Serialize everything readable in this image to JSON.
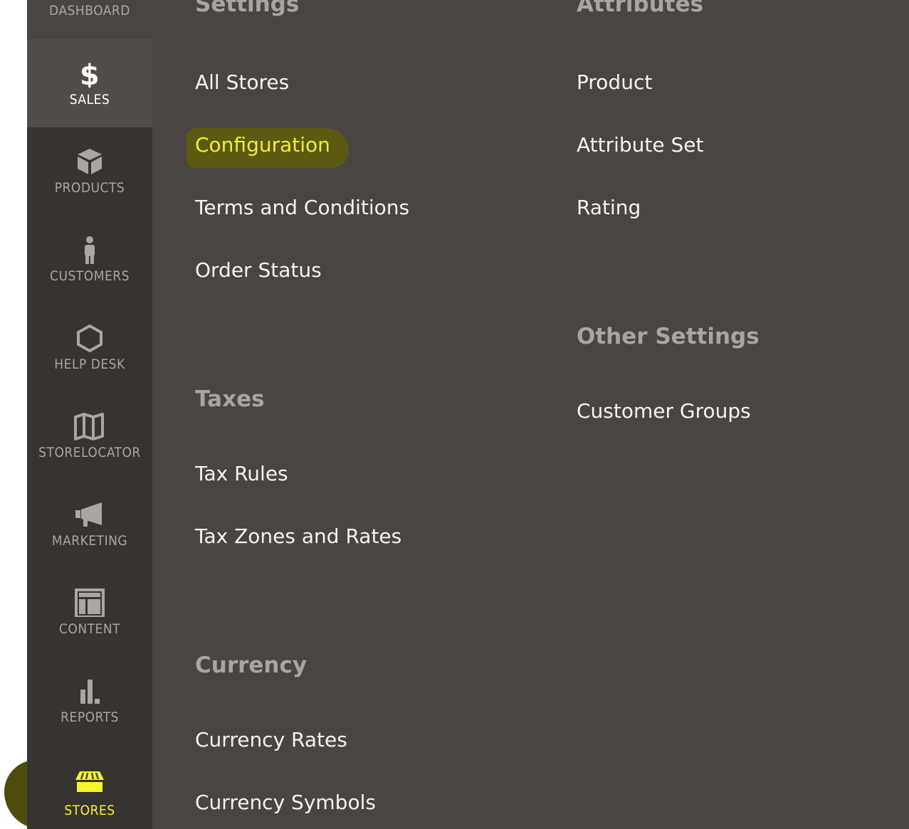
{
  "sidebar": {
    "items": [
      {
        "id": "dashboard",
        "label": "DASHBOARD",
        "icon": "dashboard-icon"
      },
      {
        "id": "sales",
        "label": "SALES",
        "icon": "dollar-icon"
      },
      {
        "id": "products",
        "label": "PRODUCTS",
        "icon": "box-icon"
      },
      {
        "id": "customers",
        "label": "CUSTOMERS",
        "icon": "person-icon"
      },
      {
        "id": "help-desk",
        "label": "HELP DESK",
        "icon": "hexagon-icon"
      },
      {
        "id": "storelocator",
        "label": "STORELOCATOR",
        "icon": "map-icon"
      },
      {
        "id": "marketing",
        "label": "MARKETING",
        "icon": "megaphone-icon"
      },
      {
        "id": "content",
        "label": "CONTENT",
        "icon": "layout-icon"
      },
      {
        "id": "reports",
        "label": "REPORTS",
        "icon": "bar-chart-icon"
      },
      {
        "id": "stores",
        "label": "STORES",
        "icon": "storefront-icon"
      }
    ]
  },
  "flyout": {
    "left": {
      "settings_title": "Settings",
      "settings_links": [
        "All Stores",
        "Configuration",
        "Terms and Conditions",
        "Order Status"
      ],
      "taxes_title": "Taxes",
      "taxes_links": [
        "Tax Rules",
        "Tax Zones and Rates"
      ],
      "currency_title": "Currency",
      "currency_links": [
        "Currency Rates",
        "Currency Symbols"
      ]
    },
    "right": {
      "attributes_title": "Attributes",
      "attributes_links": [
        "Product",
        "Attribute Set",
        "Rating"
      ],
      "other_title": "Other Settings",
      "other_links": [
        "Customer Groups"
      ]
    }
  },
  "colors": {
    "sidebar_bg": "#373330",
    "flyout_bg": "#4a4542",
    "highlight_text": "#f2ee37",
    "highlight_blob": "#4d4c0c",
    "section_title": "#a9a5a1",
    "link_text": "#f6f4f1"
  }
}
